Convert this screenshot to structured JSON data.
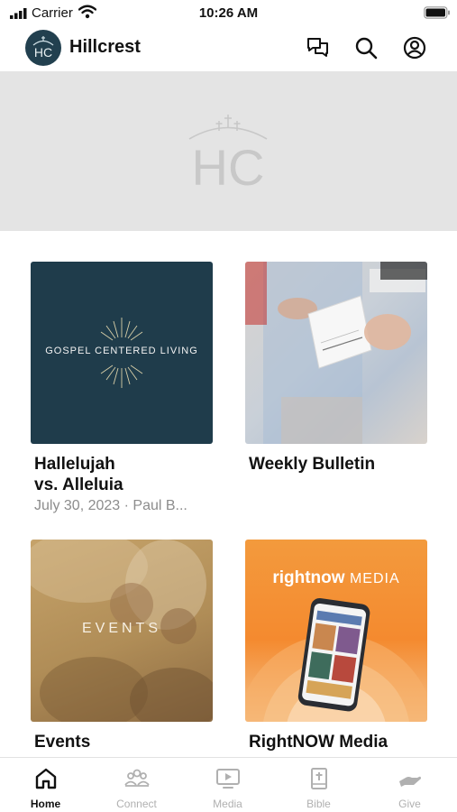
{
  "status_bar": {
    "carrier": "Carrier",
    "time": "10:26 AM"
  },
  "header": {
    "app_name": "Hillcrest",
    "logo_text": "HC"
  },
  "banner": {
    "logo_text": "HC"
  },
  "cards": [
    {
      "image_text": "GOSPEL CENTERED LIVING",
      "title": "Hallelujah\nvs. Alleluia",
      "subtitle": "July 30, 2023 · Paul B..."
    },
    {
      "image_text": "",
      "title": "Weekly Bulletin",
      "subtitle": ""
    },
    {
      "image_text": "EVENTS",
      "title": "Events",
      "subtitle": ""
    },
    {
      "image_text_bold": "rightnow",
      "image_text_light": " MEDIA",
      "title": "RightNOW Media",
      "subtitle": ""
    }
  ],
  "tabs": [
    {
      "label": "Home",
      "icon": "home-icon",
      "active": true
    },
    {
      "label": "Connect",
      "icon": "people-icon",
      "active": false
    },
    {
      "label": "Media",
      "icon": "media-icon",
      "active": false
    },
    {
      "label": "Bible",
      "icon": "bible-icon",
      "active": false
    },
    {
      "label": "Give",
      "icon": "give-icon",
      "active": false
    }
  ],
  "colors": {
    "active": "#111111",
    "inactive": "#b0b0b0",
    "avatar": "#22404f",
    "banner": "#e4e4e4"
  }
}
